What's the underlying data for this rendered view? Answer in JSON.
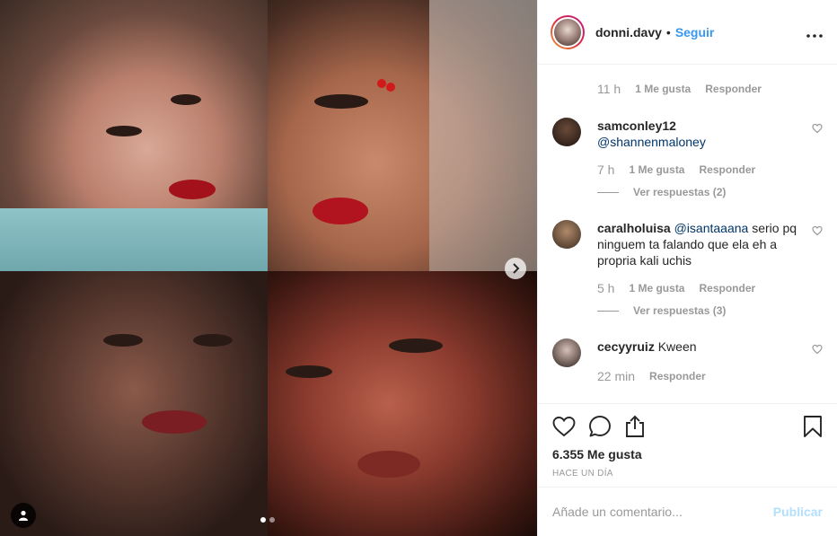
{
  "header": {
    "username": "donni.davy",
    "separator": "•",
    "follow_label": "Seguir",
    "more_label": "•••"
  },
  "comments": {
    "top_partial": {
      "time": "11 h",
      "likes": "1 Me gusta",
      "reply": "Responder"
    },
    "items": [
      {
        "username": "samconley12",
        "mention": "@shannenmaloney",
        "text": "",
        "time": "7 h",
        "likes": "1 Me gusta",
        "reply": "Responder",
        "view_replies": "Ver respuestas (2)"
      },
      {
        "username": "caralholuisa",
        "mention": "@isantaaana",
        "text": "serio pq ninguem ta falando que ela eh a propria kali uchis",
        "time": "5 h",
        "likes": "1 Me gusta",
        "reply": "Responder",
        "view_replies": "Ver respuestas (3)"
      },
      {
        "username": "cecyyruiz",
        "mention": "",
        "text": "Kween",
        "time": "22 min",
        "reply": "Responder"
      }
    ]
  },
  "actions": {
    "likes": "6.355 Me gusta",
    "posted": "HACE UN DÍA"
  },
  "add_comment": {
    "placeholder": "Añade un comentario...",
    "publish_label": "Publicar"
  },
  "colors": {
    "accent": "#3897f0",
    "link": "#003569",
    "muted": "#999999",
    "publish_disabled": "#b2dffc"
  },
  "carousel": {
    "slides": 2,
    "active_slide": 1
  }
}
